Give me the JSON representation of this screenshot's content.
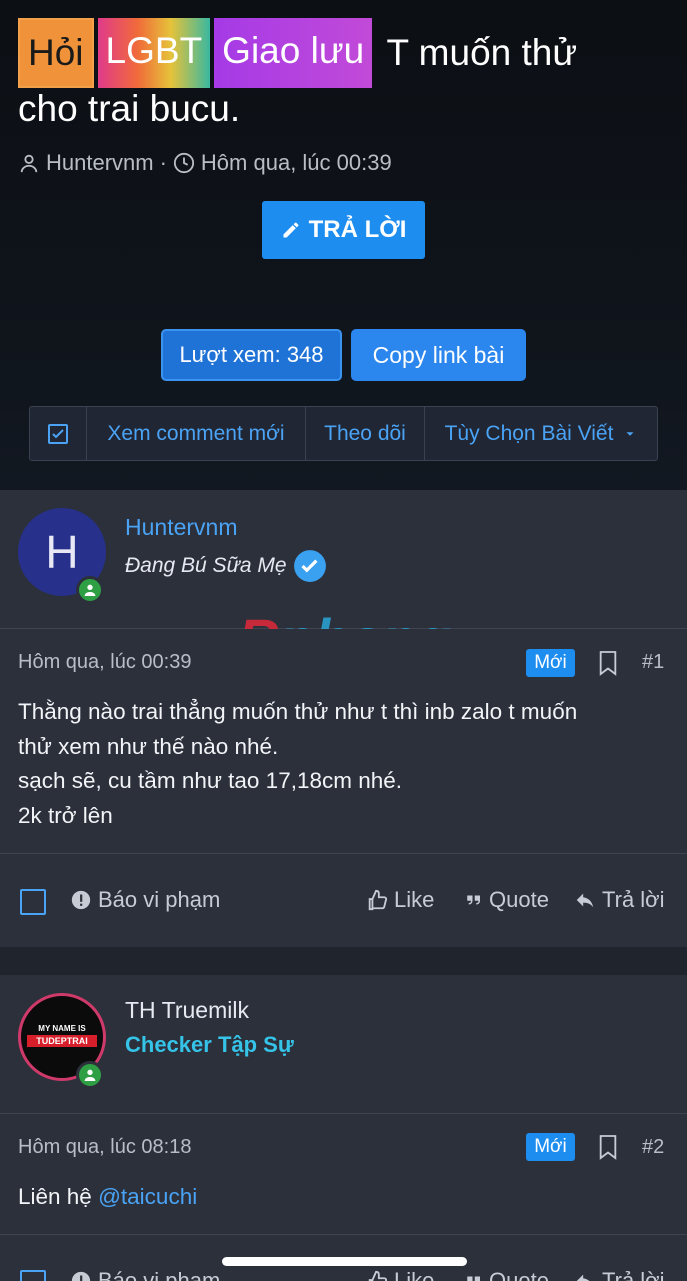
{
  "thread": {
    "prefixes": [
      "Hỏi",
      "LGBT",
      "Giao lưu"
    ],
    "title_part1": "T muốn thử",
    "title_part2": "cho trai bucu.",
    "author": "Huntervnm",
    "separator": "·",
    "date": "Hôm qua, lúc 00:39",
    "reply_button": "TRẢ LỜI",
    "views": "Lượt xem: 348",
    "copy_link": "Copy link bài"
  },
  "toolbar": {
    "new_comments": "Xem comment mới",
    "follow": "Theo dõi",
    "options": "Tùy Chọn Bài Viết"
  },
  "watermark": {
    "first": "R",
    "rest": "phang"
  },
  "posts": [
    {
      "avatar_letter": "H",
      "username": "Huntervnm",
      "user_title": "Đang Bú Sữa Mẹ",
      "date": "Hôm qua, lúc 00:39",
      "badge": "Mới",
      "number": "#1",
      "lines": [
        "Thằng nào trai thẳng muốn thử như t thì inb zalo t muốn",
        "thử xem như thế nào nhé.",
        "sạch sẽ, cu tầm như tao 17,18cm nhé.",
        "2k trở lên"
      ]
    },
    {
      "avatar_text_top": "MY NAME IS",
      "avatar_text_main": "TUDEPTRAI",
      "username": "TH Truemilk",
      "user_title": "Checker Tập Sự",
      "date": "Hôm qua, lúc 08:18",
      "badge": "Mới",
      "number": "#2",
      "text_prefix": "Liên hệ ",
      "mention": "@taicuchi"
    }
  ],
  "actions": {
    "report": "Báo vi phạm",
    "like": "Like",
    "quote": "Quote",
    "reply": "Trả lời"
  },
  "colors": {
    "accent": "#1e8df0",
    "link": "#4aa3f5",
    "username_blue": "#4aa3f5",
    "user_title_cyan": "#35c3e8",
    "online": "#2ea043"
  }
}
